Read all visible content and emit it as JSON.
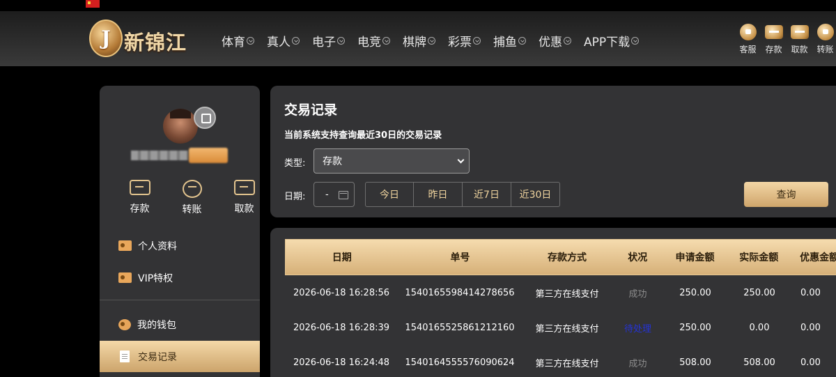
{
  "header": {
    "logo_letter": "J",
    "logo_text": "新锦江",
    "nav": [
      "体育",
      "真人",
      "电子",
      "电竞",
      "棋牌",
      "彩票",
      "捕鱼",
      "优惠",
      "APP下载"
    ],
    "tools": [
      {
        "label": "客服",
        "icon": "chat-icon"
      },
      {
        "label": "存款",
        "icon": "deposit-wallet-icon"
      },
      {
        "label": "取款",
        "icon": "withdraw-wallet-icon"
      },
      {
        "label": "转账",
        "icon": "transfer-icon"
      }
    ]
  },
  "sidebar": {
    "quick_actions": [
      {
        "label": "存款",
        "icon": "deposit-icon"
      },
      {
        "label": "转账",
        "icon": "transfer-icon"
      },
      {
        "label": "取款",
        "icon": "withdraw-icon"
      }
    ],
    "menu": [
      {
        "label": "个人资料",
        "icon": "profile-card-icon"
      },
      {
        "label": "VIP特权",
        "icon": "vip-card-icon"
      },
      {
        "label": "我的钱包",
        "icon": "piggy-bank-icon"
      },
      {
        "label": "交易记录",
        "icon": "document-icon",
        "active": true
      }
    ]
  },
  "filter": {
    "title": "交易记录",
    "note": "当前系统支持查询最近30日的交易记录",
    "type_label": "类型:",
    "type_value": "存款",
    "date_label": "日期:",
    "date_value": "-",
    "ranges": [
      "今日",
      "昨日",
      "近7日",
      "近30日"
    ],
    "query_label": "查询"
  },
  "table": {
    "headers": [
      "日期",
      "单号",
      "存款方式",
      "状况",
      "申请金额",
      "实际金额",
      "优惠金额"
    ],
    "rows": [
      {
        "date": "2026-06-18 16:28:56",
        "order_no": "1540165598414278656",
        "method": "第三方在线支付",
        "status": "成功",
        "status_type": "success",
        "requested": "250.00",
        "actual": "250.00",
        "bonus": "0.00"
      },
      {
        "date": "2026-06-18 16:28:39",
        "order_no": "1540165525861212160",
        "method": "第三方在线支付",
        "status": "待处理",
        "status_type": "pending",
        "requested": "250.00",
        "actual": "0.00",
        "bonus": "0.00"
      },
      {
        "date": "2026-06-18 16:24:48",
        "order_no": "1540164555576090624",
        "method": "第三方在线支付",
        "status": "成功",
        "status_type": "success",
        "requested": "508.00",
        "actual": "508.00",
        "bonus": "0.00"
      }
    ]
  },
  "colors": {
    "accent_gold": "#d6b078",
    "pending": "#2433d6",
    "panel_bg": "#333335"
  }
}
